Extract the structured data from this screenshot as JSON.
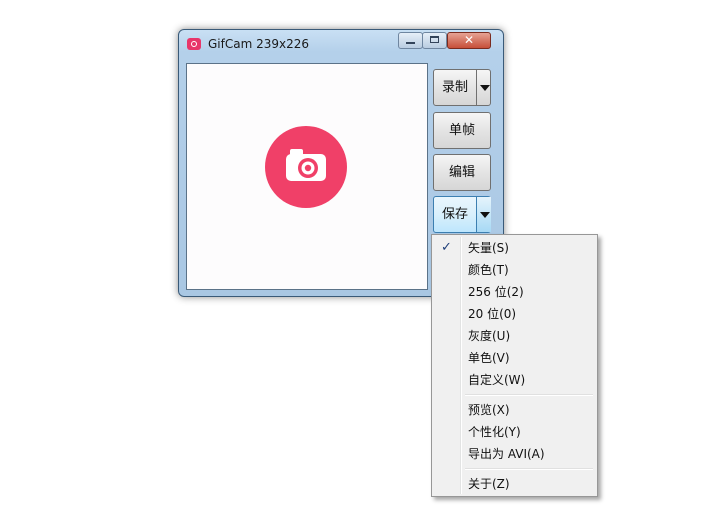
{
  "window": {
    "title": "GifCam 239x226",
    "close_label": "✕"
  },
  "buttons": {
    "record": "录制",
    "frame": "单帧",
    "edit": "编辑",
    "save": "保存"
  },
  "menu": {
    "groups": [
      [
        {
          "label": "矢量(S)",
          "checked": true
        },
        {
          "label": "颜色(T)",
          "checked": false
        },
        {
          "label": "256 位(2)",
          "checked": false
        },
        {
          "label": "20 位(0)",
          "checked": false
        },
        {
          "label": "灰度(U)",
          "checked": false
        },
        {
          "label": "单色(V)",
          "checked": false
        },
        {
          "label": "自定义(W)",
          "checked": false
        }
      ],
      [
        {
          "label": "预览(X)",
          "checked": false
        },
        {
          "label": "个性化(Y)",
          "checked": false
        },
        {
          "label": "导出为 AVI(A)",
          "checked": false
        }
      ],
      [
        {
          "label": "关于(Z)",
          "checked": false
        }
      ]
    ],
    "check_glyph": "✓"
  },
  "colors": {
    "brand": "#f04068",
    "window_frame": "#b4d0ea",
    "close_button": "#c74f39"
  }
}
